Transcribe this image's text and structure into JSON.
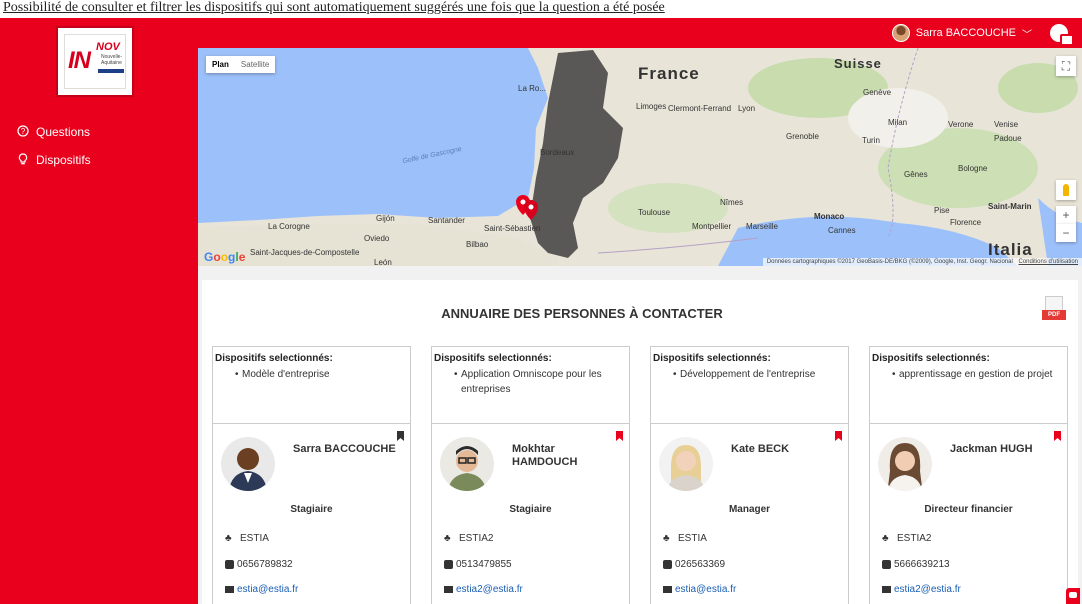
{
  "caption": "Possibilité de consulter et filtrer les dispositifs qui sont automatiquement suggérés une fois que la question a été posée",
  "logo": {
    "main": "IN",
    "nov": "NOV",
    "sub": "Nouvelle-Aquitaine"
  },
  "sidebar": {
    "items": [
      {
        "label": "Questions",
        "icon": "question-circle-icon"
      },
      {
        "label": "Dispositifs",
        "icon": "lightbulb-icon"
      }
    ]
  },
  "user": {
    "name": "Sarra BACCOUCHE"
  },
  "map": {
    "types": [
      "Plan",
      "Satellite"
    ],
    "labels": {
      "france": "France",
      "suisse": "Suisse",
      "italia": "Italia",
      "larochelle": "La Ro...",
      "geneve": "Genève",
      "limoges": "Limoges",
      "clermont": "Clermont-Ferrand",
      "lyon": "Lyon",
      "grenoble": "Grenoble",
      "turin": "Turin",
      "milan": "Milan",
      "verone": "Verone",
      "venise": "Venise",
      "padoue": "Padoue",
      "bordeaux": "Bordeaux",
      "golfe": "Golfe de Gascogne",
      "genes": "Gênes",
      "bologne": "Bologne",
      "toulouse": "Toulouse",
      "nimes": "Nîmes",
      "monaco": "Monaco",
      "saintmarin": "Saint-Marin",
      "pise": "Pise",
      "florence": "Florence",
      "cannes": "Cannes",
      "montpellier": "Montpellier",
      "marseille": "Marseille",
      "gijon": "Gijón",
      "santander": "Santander",
      "saintsebastien": "Saint-Sébastien",
      "lacorogne": "La Corogne",
      "oviedo": "Oviedo",
      "bilbao": "Bilbao",
      "compostelle": "Saint-Jacques-de-Compostelle",
      "leon": "León"
    },
    "footer": "Données cartographiques ©2017 GeoBasis-DE/BKG (©2009), Google, Inst. Geogr. Nacional",
    "footer_link": "Conditions d'utilisation",
    "google": [
      "G",
      "o",
      "o",
      "g",
      "l",
      "e"
    ]
  },
  "directory": {
    "title": "ANNUAIRE DES PERSONNES À CONTACTER",
    "pdf_label": "PDF",
    "cards": [
      {
        "heading": "Dispositifs selectionnés:",
        "items": [
          "Modèle d'entreprise"
        ],
        "name": "Sarra BACCOUCHE",
        "role": "Stagiaire",
        "org": "ESTIA",
        "phone": "0656789832",
        "email": "estia@estia.fr",
        "bookmark": "dark"
      },
      {
        "heading": "Dispositifs selectionnés:",
        "items": [
          "Application Omniscope pour les entreprises"
        ],
        "name": "Mokhtar HAMDOUCH",
        "role": "Stagiaire",
        "org": "ESTIA2",
        "phone": "0513479855",
        "email": "estia2@estia.fr",
        "bookmark": "red"
      },
      {
        "heading": "Dispositifs selectionnés:",
        "items": [
          "Développement de l'entreprise"
        ],
        "name": "Kate BECK",
        "role": "Manager",
        "org": "ESTIA",
        "phone": "026563369",
        "email": "estia@estia.fr",
        "bookmark": "red"
      },
      {
        "heading": "Dispositifs selectionnés:",
        "items": [
          "apprentissage en gestion de projet"
        ],
        "name": "Jackman HUGH",
        "role": "Directeur financier",
        "org": "ESTIA2",
        "phone": "5666639213",
        "email": "estia2@estia.fr",
        "bookmark": "red"
      }
    ]
  },
  "colors": {
    "brand": "#e8001c",
    "link": "#1a5fb4",
    "region": "#3f3f3f"
  }
}
